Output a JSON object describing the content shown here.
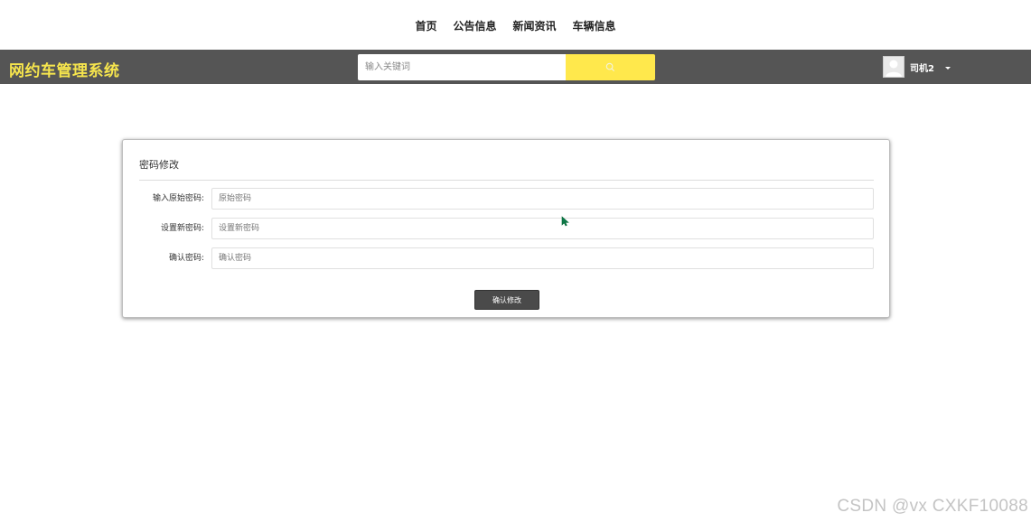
{
  "nav": {
    "items": [
      {
        "label": "首页"
      },
      {
        "label": "公告信息"
      },
      {
        "label": "新闻资讯"
      },
      {
        "label": "车辆信息"
      }
    ]
  },
  "header": {
    "brand": "网约车管理系统",
    "brand_color": "#f6e54d",
    "bar_color": "#555555",
    "search": {
      "placeholder": "输入关键词",
      "value": "",
      "button_icon": "search-icon",
      "button_color": "#ffe84c"
    },
    "user": {
      "name": "司机2",
      "avatar_icon": "user-avatar-icon",
      "dropdown_icon": "caret-down-icon"
    }
  },
  "form": {
    "title": "密码修改",
    "fields": [
      {
        "label": "输入原始密码:",
        "placeholder": "原始密码",
        "value": ""
      },
      {
        "label": "设置新密码:",
        "placeholder": "设置新密码",
        "value": ""
      },
      {
        "label": "确认密码:",
        "placeholder": "确认密码",
        "value": ""
      }
    ],
    "submit_label": "确认修改"
  },
  "watermark": "CSDN @vx  CXKF10088"
}
